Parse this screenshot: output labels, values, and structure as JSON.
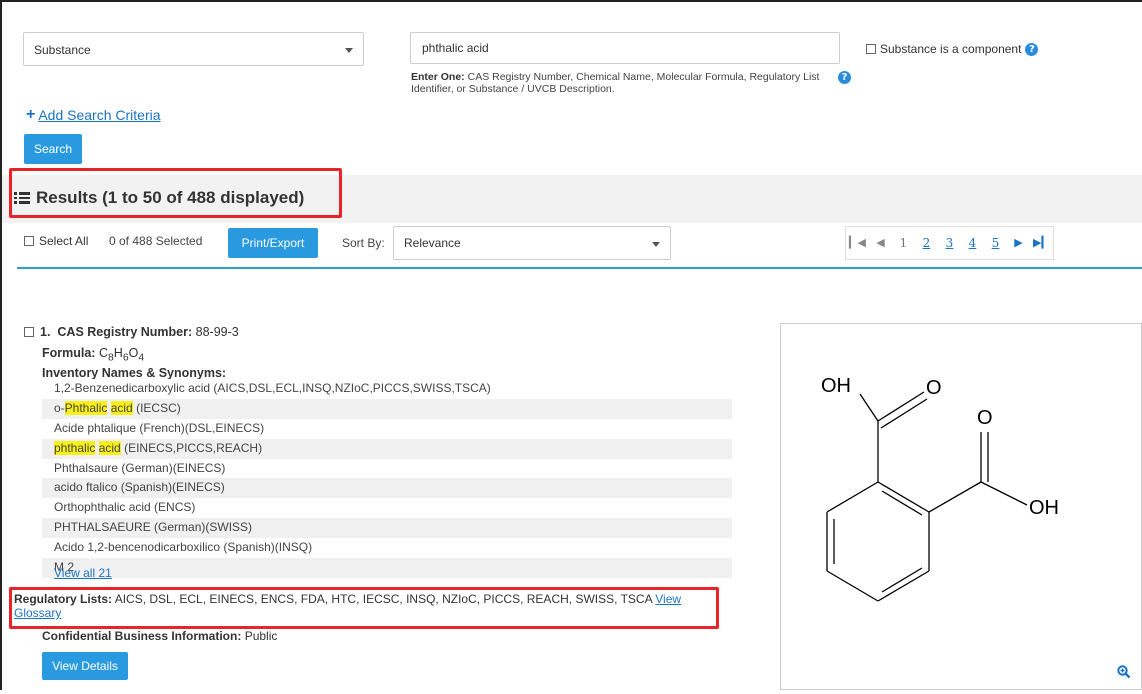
{
  "search": {
    "field_select": "Substance",
    "query": "phthalic acid",
    "hint_bold": "Enter One:",
    "hint_text": "CAS Registry Number, Chemical Name, Molecular Formula, Regulatory List Identifier, or Substance / UVCB Description.",
    "component_label": "Substance is a component",
    "add_criteria": "Add Search Criteria",
    "search_button": "Search"
  },
  "results": {
    "title": "Results (1 to 50 of 488 displayed)",
    "select_all": "Select All",
    "selected_count": "0 of 488 Selected",
    "print_export": "Print/Export",
    "sort_label": "Sort By:",
    "sort_value": "Relevance",
    "pager": {
      "current": "1",
      "pages": [
        "2",
        "3",
        "4",
        "5"
      ]
    }
  },
  "item": {
    "index": "1.",
    "cas_label": "CAS Registry Number:",
    "cas_value": "88-99-3",
    "formula_label": "Formula:",
    "formula": {
      "c": "C",
      "c_n": "8",
      "h": "H",
      "h_n": "6",
      "o": "O",
      "o_n": "4"
    },
    "inventory_label": "Inventory Names & Synonyms:",
    "synonyms": [
      {
        "pre": "1,2-Benzenedicarboxylic acid (AICS,DSL,ECL,INSQ,NZIoC,PICCS,SWISS,TSCA)"
      },
      {
        "pre": "o-",
        "hl1": "Phthalic",
        "mid": " ",
        "hl2": "acid",
        "post": " (IECSC)"
      },
      {
        "pre": "Acide phtalique (French)(DSL,EINECS)"
      },
      {
        "hl1": "phthalic",
        "mid": " ",
        "hl2": "acid",
        "post": " (EINECS,PICCS,REACH)"
      },
      {
        "pre": "Phthalsaure (German)(EINECS)"
      },
      {
        "pre": "acido ftalico (Spanish)(EINECS)"
      },
      {
        "pre": "Orthophthalic acid (ENCS)"
      },
      {
        "pre": "PHTHALSAEURE (German)(SWISS)"
      },
      {
        "pre": "Acido 1,2-bencenodicarboxilico (Spanish)(INSQ)"
      },
      {
        "pre": "M 2"
      }
    ],
    "view_all": "View all 21",
    "reg_label": "Regulatory Lists:",
    "reg_value": "AICS, DSL, ECL, EINECS, ENCS, FDA, HTC, IECSC, INSQ, NZIoC, PICCS, REACH, SWISS, TSCA",
    "reg_link": "View Glossary",
    "cbi_label": "Confidential Business Information:",
    "cbi_value": "Public",
    "details_button": "View Details"
  },
  "structure": {
    "atoms": {
      "oh1": "OH",
      "o1": "O",
      "o2": "O",
      "oh2": "OH"
    }
  },
  "colors": {
    "accent_blue": "#2a9ae0",
    "link_blue": "#1a73c4",
    "highlight_box": "#e8242a",
    "search_highlight": "#f8f01a",
    "rule": "#2ea3c7"
  }
}
